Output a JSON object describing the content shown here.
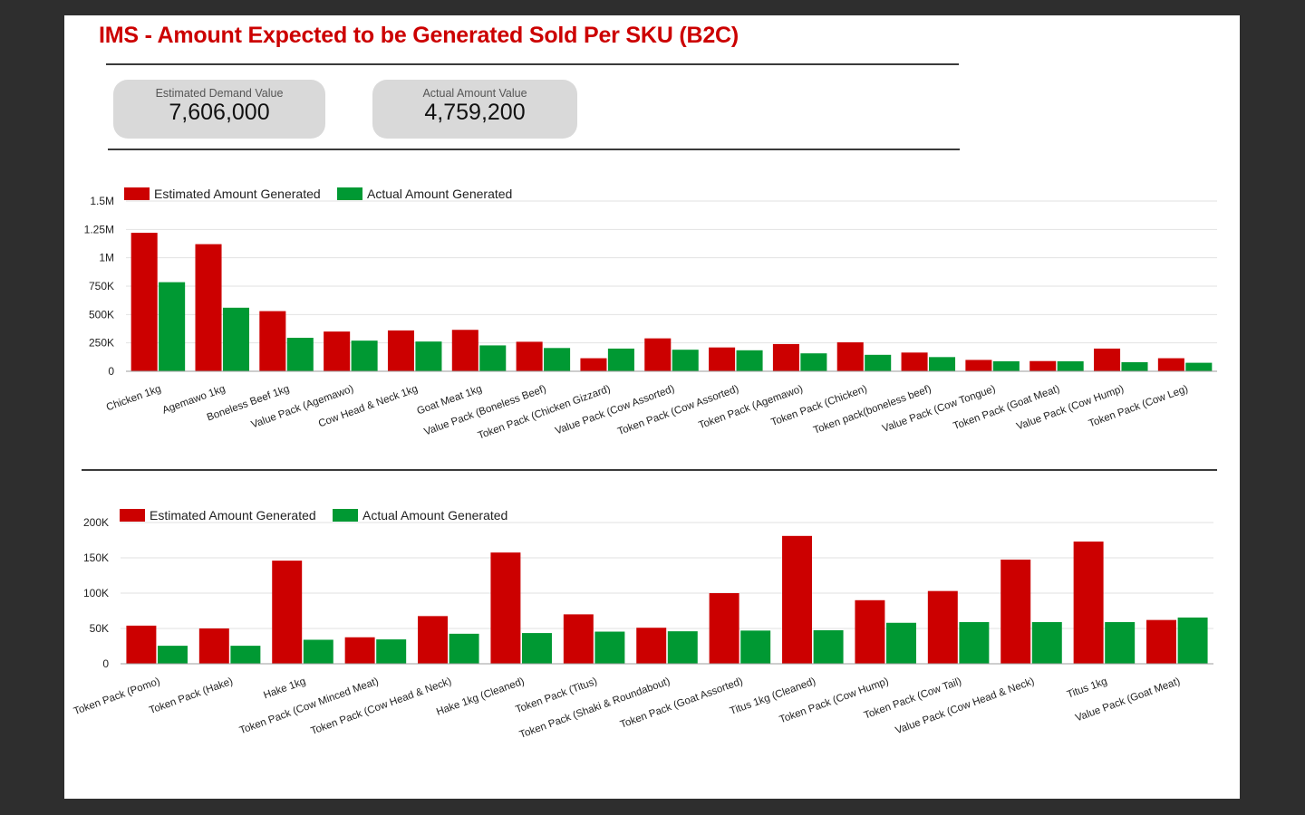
{
  "report": {
    "title": "IMS - Amount Expected to be Generated Sold Per SKU (B2C)"
  },
  "kpis": [
    {
      "label": "Estimated Demand Value",
      "value": "7,606,000"
    },
    {
      "label": "Actual Amount Value",
      "value": "4,759,200"
    }
  ],
  "colors": {
    "estimated": "#cc0000",
    "actual": "#009933",
    "grid": "#e2e2e2",
    "axis": "#9e9e9e"
  },
  "chart_data": [
    {
      "type": "bar",
      "legend_position": "top-left",
      "grid": true,
      "ylim": [
        0,
        1500000
      ],
      "yticks": [
        {
          "value": 0,
          "label": "0"
        },
        {
          "value": 250000,
          "label": "250K"
        },
        {
          "value": 500000,
          "label": "500K"
        },
        {
          "value": 750000,
          "label": "750K"
        },
        {
          "value": 1000000,
          "label": "1M"
        },
        {
          "value": 1250000,
          "label": "1.25M"
        },
        {
          "value": 1500000,
          "label": "1.5M"
        }
      ],
      "categories": [
        "Chicken 1kg",
        "Agemawo 1kg",
        "Boneless Beef 1kg",
        "Value Pack (Agemawo)",
        "Cow Head & Neck 1kg",
        "Goat Meat 1kg",
        "Value Pack (Boneless Beef)",
        "Token Pack (Chicken Gizzard)",
        "Value Pack (Cow Assorted)",
        "Token Pack (Cow Assorted)",
        "Token Pack (Agemawo)",
        "Token Pack (Chicken)",
        "Token pack(boneless beef)",
        "Value Pack (Cow Tongue)",
        "Token Pack (Goat Meat)",
        "Value Pack (Cow Hump)",
        "Token Pack (Cow Leg)"
      ],
      "series": [
        {
          "name": "Estimated Amount Generated",
          "values": [
            1220000,
            1120000,
            530000,
            350000,
            360000,
            365000,
            260000,
            115000,
            290000,
            210000,
            240000,
            255000,
            165000,
            100000,
            90000,
            200000,
            115000
          ]
        },
        {
          "name": "Actual Amount Generated",
          "values": [
            785000,
            560000,
            295000,
            270000,
            262000,
            228000,
            205000,
            200000,
            190000,
            185000,
            158000,
            145000,
            125000,
            88000,
            88000,
            80000,
            75000
          ]
        }
      ]
    },
    {
      "type": "bar",
      "legend_position": "top-left",
      "grid": true,
      "ylim": [
        0,
        200000
      ],
      "yticks": [
        {
          "value": 0,
          "label": "0"
        },
        {
          "value": 50000,
          "label": "50K"
        },
        {
          "value": 100000,
          "label": "100K"
        },
        {
          "value": 150000,
          "label": "150K"
        },
        {
          "value": 200000,
          "label": "200K"
        }
      ],
      "categories": [
        "Token Pack (Pomo)",
        "Token Pack (Hake)",
        "Hake 1kg",
        "Token Pack (Cow Minced Meat)",
        "Token Pack (Cow Head & Neck)",
        "Hake 1kg (Cleaned)",
        "Token Pack (Titus)",
        "Token Pack (Shaki & Roundabout)",
        "Token Pack (Goat Assorted)",
        "Titus 1kg (Cleaned)",
        "Token Pack (Cow Hump)",
        "Token Pack (Cow Tail)",
        "Value Pack (Cow Head & Neck)",
        "Titus 1kg",
        "Value Pack (Goat Meat)"
      ],
      "series": [
        {
          "name": "Estimated Amount Generated",
          "values": [
            54000,
            50000,
            146000,
            37500,
            67500,
            157500,
            70000,
            51000,
            100000,
            181000,
            90000,
            103000,
            147500,
            173000,
            62000
          ]
        },
        {
          "name": "Actual Amount Generated",
          "values": [
            25500,
            25500,
            34000,
            34500,
            42500,
            43500,
            45500,
            46000,
            47000,
            47500,
            58000,
            59000,
            59000,
            59000,
            65500
          ]
        }
      ]
    }
  ]
}
